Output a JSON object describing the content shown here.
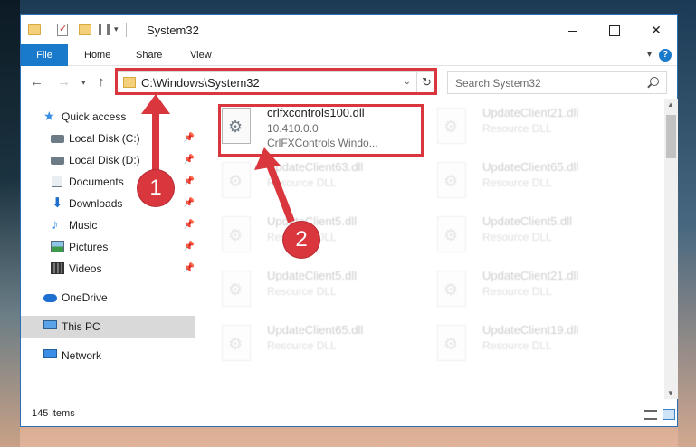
{
  "window": {
    "title": "System32",
    "qa_dropdown_glyph": "▾"
  },
  "ribbon": {
    "tabs": [
      {
        "label": "File",
        "active": true
      },
      {
        "label": "Home"
      },
      {
        "label": "Share"
      },
      {
        "label": "View"
      }
    ]
  },
  "address": {
    "path": "C:\\Windows\\System32",
    "search_placeholder": "Search System32"
  },
  "navpane": {
    "items": [
      {
        "label": "Quick access",
        "icon": "star-icon",
        "pinned": false
      },
      {
        "label": "Local Disk (C:)",
        "icon": "disk-icon",
        "pinned": true
      },
      {
        "label": "Local Disk (D:)",
        "icon": "disk-icon",
        "pinned": true
      },
      {
        "label": "Documents",
        "icon": "documents-icon",
        "pinned": true
      },
      {
        "label": "Downloads",
        "icon": "download-icon",
        "pinned": true
      },
      {
        "label": "Music",
        "icon": "music-icon",
        "pinned": true
      },
      {
        "label": "Pictures",
        "icon": "pictures-icon",
        "pinned": true
      },
      {
        "label": "Videos",
        "icon": "videos-icon",
        "pinned": true
      },
      {
        "label": "OneDrive",
        "icon": "onedrive-icon",
        "pinned": false
      },
      {
        "label": "This PC",
        "icon": "this-pc-icon",
        "pinned": false,
        "selected": true
      },
      {
        "label": "Network",
        "icon": "network-icon",
        "pinned": false
      }
    ]
  },
  "files": [
    {
      "name": "crlfxcontrols100.dll",
      "line2": "10.410.0.0",
      "line3": "CrlFXControls Windo...",
      "highlighted": true
    },
    {
      "name": "UpdateClient21.dll",
      "line2": "Resource DLL",
      "line3": ""
    },
    {
      "name": "UpdateClient63.dll",
      "line2": "Resource DLL",
      "line3": ""
    },
    {
      "name": "UpdateClient65.dll",
      "line2": "Resource DLL",
      "line3": ""
    },
    {
      "name": "UpdateClient5.dll",
      "line2": "Resource DLL",
      "line3": ""
    },
    {
      "name": "UpdateClient5.dll",
      "line2": "Resource DLL",
      "line3": ""
    },
    {
      "name": "UpdateClient5.dll",
      "line2": "Resource DLL",
      "line3": ""
    },
    {
      "name": "UpdateClient21.dll",
      "line2": "Resource DLL",
      "line3": ""
    },
    {
      "name": "UpdateClient65.dll",
      "line2": "Resource DLL",
      "line3": ""
    },
    {
      "name": "UpdateClient19.dll",
      "line2": "Resource DLL",
      "line3": ""
    }
  ],
  "status": {
    "item_count": "145 items"
  },
  "annotations": {
    "marker_1": "1",
    "marker_2": "2",
    "color": "#d9363e"
  },
  "colors": {
    "accent": "#1979ca"
  }
}
